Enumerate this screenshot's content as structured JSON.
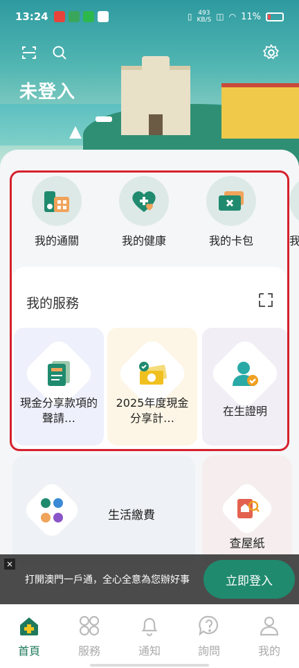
{
  "status": {
    "time": "13:24",
    "net_speed_value": "493",
    "net_speed_unit": "KB/S",
    "battery": "11%"
  },
  "header": {
    "title": "未登入"
  },
  "quick": [
    {
      "label": "我的通關",
      "icon": "customs-icon"
    },
    {
      "label": "我的健康",
      "icon": "health-heart-icon"
    },
    {
      "label": "我的卡包",
      "icon": "card-wallet-icon"
    },
    {
      "label": "我"
    }
  ],
  "services": {
    "title": "我的服務",
    "items": [
      {
        "label": "現金分享款項的聲請…",
        "icon": "document-icon"
      },
      {
        "label": "2025年度現金分享計…",
        "icon": "money-icon"
      },
      {
        "label": "在生證明",
        "icon": "person-check-icon"
      }
    ]
  },
  "cards": {
    "utility": {
      "label": "生活繳費",
      "icon": "utilities-icon"
    },
    "house": {
      "label": "查屋紙",
      "icon": "house-search-icon"
    }
  },
  "login": {
    "close": "×",
    "message": "打開澳門一戶通，全心全意為您辦好事",
    "button": "立即登入"
  },
  "nav": [
    {
      "label": "首頁",
      "icon": "home-icon"
    },
    {
      "label": "服務",
      "icon": "grid-icon"
    },
    {
      "label": "通知",
      "icon": "bell-icon"
    },
    {
      "label": "詢問",
      "icon": "question-icon"
    },
    {
      "label": "我的",
      "icon": "user-icon"
    }
  ],
  "colors": {
    "accent": "#1f7a5c",
    "highlight": "#d6202c"
  }
}
